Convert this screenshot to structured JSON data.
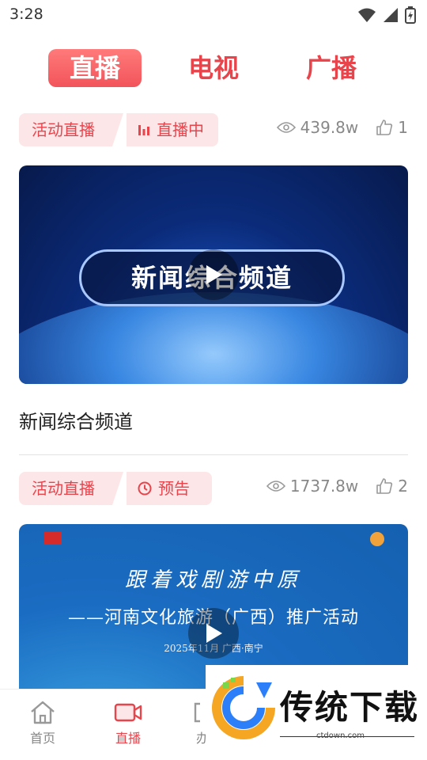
{
  "status_bar": {
    "time": "3:28"
  },
  "top_tabs": [
    {
      "label": "直播",
      "active": true
    },
    {
      "label": "电视",
      "active": false
    },
    {
      "label": "广播",
      "active": false
    }
  ],
  "items": [
    {
      "tag": "活动直播",
      "status": "直播中",
      "status_icon": "live-bars-icon",
      "views": "439.8w",
      "likes": "1",
      "thumbnail_text": "新闻综合频道",
      "title": "新闻综合频道"
    },
    {
      "tag": "活动直播",
      "status": "预告",
      "status_icon": "clock-icon",
      "views": "1737.8w",
      "likes": "2",
      "banner_line1": "跟着戏剧游中原",
      "banner_line2": "——河南文化旅游（广西）推广活动",
      "banner_line3": "2025年11月 广西·南宁"
    }
  ],
  "bottom_nav": [
    {
      "label": "首页",
      "icon": "home-icon",
      "active": false
    },
    {
      "label": "直播",
      "icon": "video-camera-icon",
      "active": true
    },
    {
      "label": "办",
      "icon": "bracket-icon",
      "active": false
    }
  ],
  "watermark": {
    "brand": "传统下载",
    "url": "ctdown.com"
  },
  "colors": {
    "accent": "#e8444c",
    "tag_bg": "#fde6e7"
  }
}
